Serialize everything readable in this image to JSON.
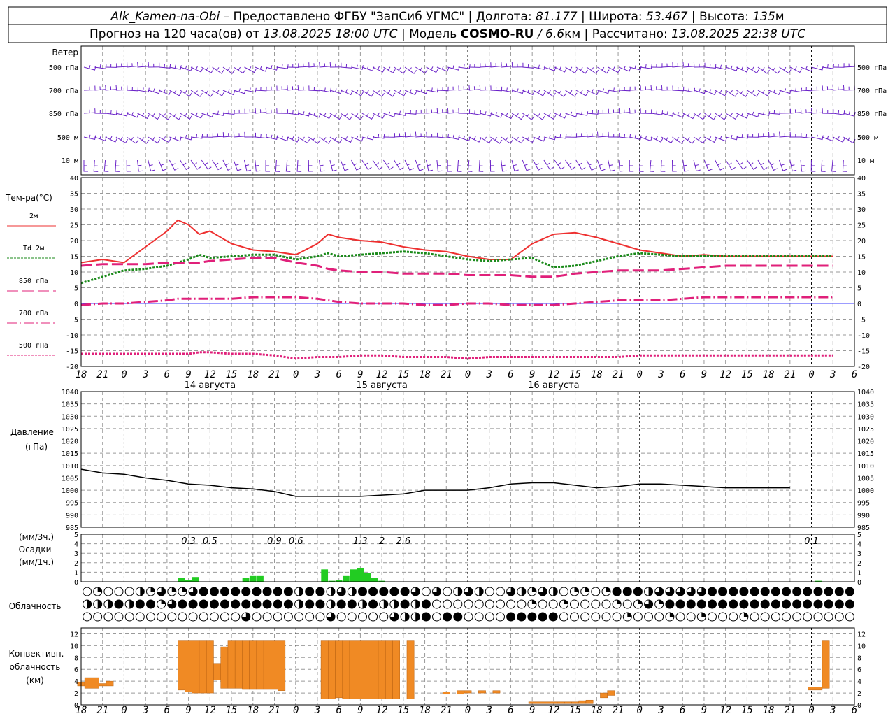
{
  "header": {
    "station": "Alk_Kamen-na-Obi",
    "provided_by": "Предоставлено ФГБУ \"ЗапСиб УГМС\"",
    "lon_label": "Долгота:",
    "lon": "81.177",
    "lat_label": "Широта:",
    "lat": "53.467",
    "alt_label": "Высота:",
    "alt": "135",
    "alt_unit": "м",
    "forecast_label": "Прогноз на 120 часа(ов) от",
    "forecast_time": "13.08.2025 18:00 UTC",
    "model_label": "Модель",
    "model": "COSMO-RU",
    "model_res": "/ 6.6",
    "model_res_unit": "км",
    "calc_label": "Рассчитано:",
    "calc_time": "13.08.2025 22:38 UTC"
  },
  "chart_data": [
    {
      "type": "wind_barbs",
      "title": "Ветер",
      "levels": [
        "500 гПа",
        "700 гПа",
        "850 гПа",
        "500 м",
        "10 м"
      ],
      "color": "#6a22c8"
    },
    {
      "type": "line",
      "title": "Тем-ра(°C)",
      "ylim": [
        -20,
        40
      ],
      "yticks": [
        -20,
        -15,
        -10,
        -5,
        0,
        5,
        10,
        15,
        20,
        25,
        30,
        35,
        40
      ],
      "x": [
        -6,
        -3,
        0,
        3,
        6,
        7.5,
        9,
        10.5,
        12,
        15,
        18,
        21,
        24,
        27,
        28.5,
        30,
        33,
        36,
        39,
        42,
        45,
        48,
        51,
        54,
        57,
        60,
        63,
        66,
        69,
        72,
        75,
        78,
        81,
        84,
        87,
        90,
        93,
        96,
        99
      ],
      "series": [
        {
          "name": "2м",
          "color": "#ee3030",
          "dash": "",
          "values": [
            13,
            14,
            13,
            18,
            23,
            26.5,
            25,
            22,
            23,
            19,
            17,
            16.5,
            15.5,
            19,
            22,
            21,
            20,
            19.5,
            18,
            17,
            16.5,
            15,
            14,
            14,
            19,
            22,
            22.5,
            21,
            19,
            17,
            16,
            15,
            15.5,
            15,
            15,
            15,
            15,
            15,
            15
          ]
        },
        {
          "name": "Td  2м",
          "color": "#1a8a1a",
          "dash": "3 2",
          "values": [
            6.5,
            8.5,
            10.5,
            11,
            12,
            13,
            14,
            15.5,
            14.5,
            15,
            15.5,
            15.5,
            14,
            15,
            16,
            15,
            15.5,
            16,
            16.5,
            16,
            15,
            14,
            13.5,
            14,
            14.5,
            11.5,
            12,
            13.5,
            15,
            16,
            15.5,
            15,
            15,
            15,
            15,
            15,
            15,
            15,
            15
          ]
        },
        {
          "name": "850 гПа",
          "color": "#e0207a",
          "dash": "16 6",
          "values": [
            12,
            12.5,
            12.5,
            12.5,
            13,
            13,
            13,
            13,
            13.5,
            14,
            14.5,
            14.5,
            13,
            12,
            11,
            10.5,
            10,
            10,
            9.5,
            9.5,
            9.5,
            9,
            9,
            9,
            8.5,
            8.5,
            9.5,
            10,
            10.5,
            10.5,
            10.5,
            11,
            11.5,
            12,
            12,
            12,
            12,
            12,
            12
          ]
        },
        {
          "name": "700 гПа",
          "color": "#e0207a",
          "dash": "14 4 2 4",
          "values": [
            -0.5,
            0,
            0,
            0.5,
            1,
            1.5,
            1.5,
            1.5,
            1.5,
            1.5,
            2,
            2,
            2,
            1.5,
            1,
            0.5,
            0,
            0,
            0,
            -0.5,
            -0.5,
            0,
            0,
            -0.5,
            -0.5,
            -0.5,
            0,
            0.5,
            1,
            1,
            1,
            1.5,
            2,
            2,
            2,
            2,
            2,
            2,
            2
          ]
        },
        {
          "name": "500 гПа",
          "color": "#e0207a",
          "dash": "3 2",
          "values": [
            -16,
            -16,
            -16,
            -16,
            -16,
            -16,
            -16,
            -15.5,
            -15.5,
            -16,
            -16,
            -16.5,
            -17.5,
            -17,
            -17,
            -17,
            -16.5,
            -16.5,
            -17,
            -17,
            -17,
            -17.5,
            -17,
            -17,
            -17,
            -17,
            -17,
            -17,
            -17,
            -16.5,
            -16.5,
            -16.5,
            -16.5,
            -16.5,
            -16.5,
            -16.5,
            -16.5,
            -16.5,
            -16.5
          ]
        }
      ]
    },
    {
      "type": "line",
      "title": "Давление",
      "ylabel": "(гПа)",
      "ylim": [
        985,
        1040
      ],
      "yticks": [
        985,
        990,
        995,
        1000,
        1005,
        1010,
        1015,
        1020,
        1025,
        1030,
        1035,
        1040
      ],
      "x": [
        -6,
        -3,
        0,
        3,
        6,
        9,
        12,
        15,
        18,
        21,
        24,
        27,
        30,
        33,
        36,
        39,
        42,
        45,
        48,
        51,
        54,
        57,
        60,
        63,
        66,
        69,
        72,
        75,
        78,
        81,
        84,
        87,
        90,
        93
      ],
      "series": [
        {
          "name": "",
          "color": "#000000",
          "values": [
            1008.5,
            1007,
            1006.5,
            1005,
            1004,
            1002.5,
            1002,
            1001,
            1000.5,
            999.5,
            997.5,
            997.5,
            997.5,
            997.5,
            998,
            998.5,
            1000,
            1000,
            1000,
            1001,
            1002.5,
            1003,
            1003,
            1002,
            1001,
            1001.5,
            1002.5,
            1002.5,
            1002,
            1001.5,
            1001,
            1001,
            1001,
            1001
          ]
        }
      ]
    },
    {
      "type": "bar",
      "title": "Осадки",
      "ylabel_top": "(мм/3ч.)",
      "ylabel_bottom": "(мм/1ч.)",
      "ylim": [
        0,
        5
      ],
      "yticks": [
        0,
        1,
        2,
        3,
        4,
        5
      ],
      "color": "#22cc22",
      "x": [
        8,
        9,
        10,
        17,
        18,
        19,
        28,
        29,
        30,
        31,
        32,
        33,
        34,
        35,
        36,
        97
      ],
      "values": [
        0.4,
        0.2,
        0.5,
        0.4,
        0.6,
        0.6,
        1.3,
        0.1,
        0.2,
        0.6,
        1.3,
        1.4,
        0.9,
        0.4,
        0.1,
        0.1
      ],
      "totals": [
        "0.3",
        "0.5",
        "0.9",
        "0.6",
        "1.3",
        "2",
        "2.6",
        "0.1"
      ],
      "totals_x": [
        9,
        12,
        21,
        24,
        33,
        36,
        39,
        96
      ]
    },
    {
      "type": "table",
      "title": "Облачность",
      "rows": 3,
      "columns": 40,
      "cover_eighths": [
        [
          0,
          2,
          0,
          0,
          0,
          4,
          2,
          6,
          2,
          2,
          6,
          8,
          8,
          8,
          8,
          8,
          8,
          8,
          8,
          8,
          4,
          8,
          8,
          4,
          6,
          4,
          8,
          8,
          8,
          8,
          8,
          6,
          0,
          6,
          0,
          4,
          6,
          4,
          0,
          0,
          6,
          4,
          2,
          6,
          4,
          0,
          2,
          2,
          0,
          2,
          8,
          8,
          8,
          4,
          6,
          6,
          6,
          6,
          6,
          8,
          8,
          8,
          8,
          8,
          8,
          8,
          8,
          8,
          8,
          8,
          8,
          8,
          8
        ],
        [
          4,
          4,
          4,
          8,
          4,
          8,
          8,
          2,
          6,
          8,
          8,
          8,
          8,
          8,
          8,
          8,
          8,
          8,
          8,
          8,
          4,
          8,
          8,
          4,
          8,
          8,
          4,
          8,
          4,
          4,
          8,
          4,
          8,
          0,
          0,
          0,
          0,
          0,
          0,
          0,
          0,
          0,
          2,
          0,
          0,
          2,
          0,
          0,
          0,
          0,
          2,
          0,
          2,
          6,
          2,
          8,
          8,
          8,
          8,
          8,
          8,
          8,
          8,
          8,
          8,
          8,
          8,
          8,
          8,
          8,
          8,
          8,
          8
        ],
        [
          0,
          0,
          0,
          0,
          0,
          0,
          0,
          0,
          0,
          0,
          0,
          0,
          0,
          0,
          0,
          6,
          0,
          0,
          0,
          0,
          0,
          0,
          0,
          6,
          0,
          0,
          0,
          0,
          0,
          6,
          4,
          4,
          8,
          0,
          8,
          8,
          0,
          0,
          0,
          0,
          8,
          8,
          8,
          8,
          8,
          0,
          0,
          0,
          0,
          0,
          0,
          2,
          0,
          0,
          0,
          2,
          0,
          0,
          2,
          0,
          0,
          0,
          2,
          0,
          0,
          0,
          0,
          0,
          0,
          0,
          0,
          0,
          0
        ]
      ]
    },
    {
      "type": "bar",
      "title": "Конвективн.",
      "title2": "облачность",
      "ylabel": "(км)",
      "ylim": [
        0,
        13
      ],
      "yticks": [
        0,
        2,
        4,
        6,
        8,
        10,
        12
      ],
      "color": "#f08a24",
      "x": [
        -6,
        -5,
        -4,
        -3,
        -2,
        8,
        9,
        10,
        11,
        12,
        13,
        14,
        15,
        16,
        17,
        18,
        19,
        20,
        21,
        22,
        28,
        29,
        30,
        31,
        32,
        33,
        34,
        35,
        36,
        37,
        38,
        40,
        45,
        47,
        48,
        50,
        52,
        57,
        58,
        59,
        60,
        61,
        62,
        63,
        64,
        65,
        67,
        68,
        96,
        97,
        98
      ],
      "bottoms": [
        3.2,
        2.8,
        2.8,
        3.2,
        3.2,
        2.5,
        2.2,
        2.0,
        2.0,
        2.0,
        4.2,
        2.8,
        2.8,
        2.8,
        2.6,
        2.6,
        2.6,
        2.6,
        2.6,
        2.4,
        1.0,
        1.0,
        1.2,
        1.0,
        1.0,
        1.0,
        1.0,
        1.0,
        1.0,
        1.0,
        1.0,
        1.0,
        1.8,
        1.8,
        2.0,
        2.0,
        2.0,
        0.2,
        0.2,
        0.2,
        0.2,
        0.2,
        0.2,
        0.2,
        0.2,
        0.2,
        1.2,
        1.6,
        2.5,
        2.5,
        2.8
      ],
      "tops": [
        3.8,
        4.6,
        4.6,
        3.6,
        4.0,
        10.8,
        10.8,
        10.8,
        10.8,
        10.8,
        7.0,
        9.8,
        10.8,
        10.8,
        10.8,
        10.8,
        10.8,
        10.8,
        10.8,
        10.8,
        10.8,
        10.8,
        10.8,
        10.8,
        10.8,
        10.8,
        10.8,
        10.8,
        10.8,
        10.8,
        10.8,
        10.8,
        2.2,
        2.4,
        2.4,
        2.4,
        2.4,
        0.5,
        0.5,
        0.5,
        0.5,
        0.5,
        0.5,
        0.5,
        0.7,
        0.8,
        2.0,
        2.4,
        3.0,
        3.0,
        10.8
      ]
    }
  ],
  "time_axis": {
    "tick_labels": [
      "18",
      "21",
      "0",
      "3",
      "6",
      "9",
      "12",
      "15",
      "18",
      "21",
      "0",
      "3",
      "6",
      "9",
      "12",
      "15",
      "18",
      "21",
      "0",
      "3",
      "6",
      "9",
      "12",
      "15",
      "18",
      "21",
      "0"
    ],
    "days": [
      "14 августа",
      "15 августа",
      "16 августа"
    ]
  }
}
